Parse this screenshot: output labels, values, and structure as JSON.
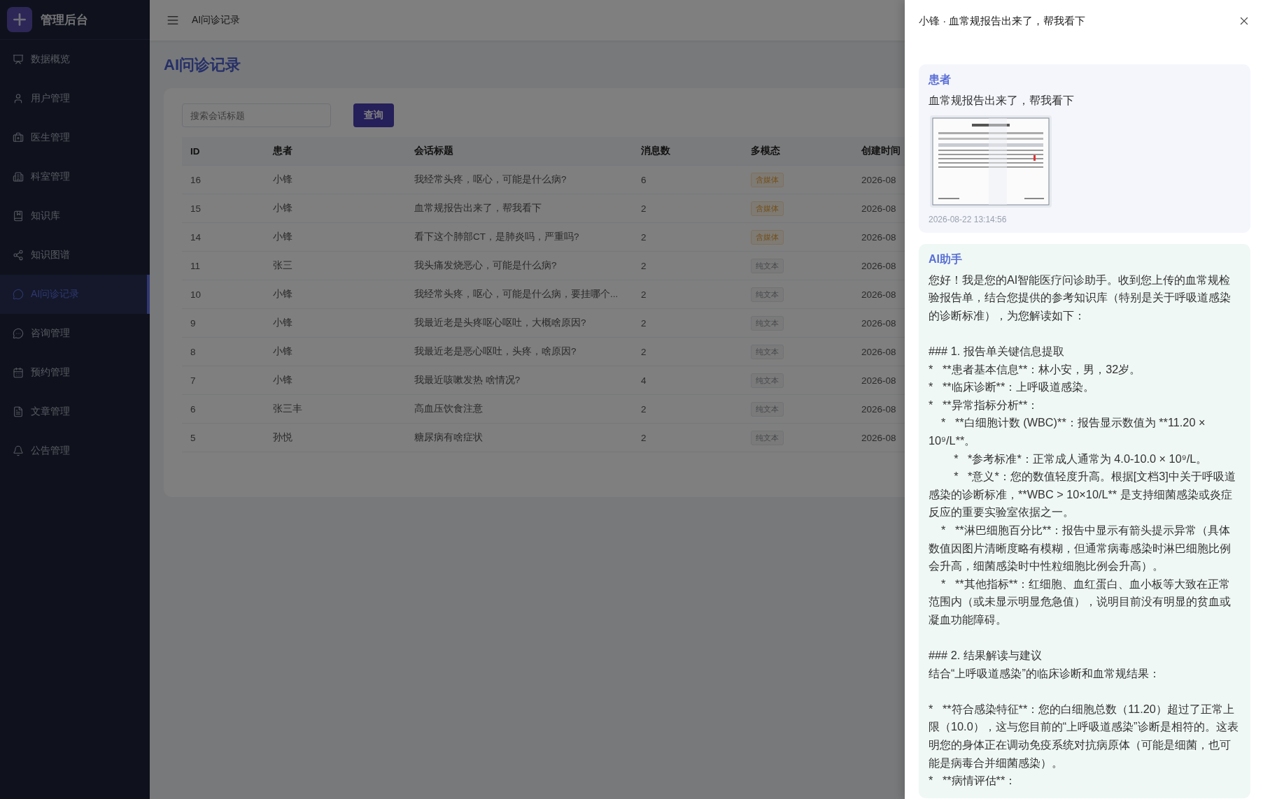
{
  "sidebar": {
    "brand": "管理后台",
    "items": [
      {
        "label": "数据概览",
        "selected": false
      },
      {
        "label": "用户管理",
        "selected": false
      },
      {
        "label": "医生管理",
        "selected": false
      },
      {
        "label": "科室管理",
        "selected": false
      },
      {
        "label": "知识库",
        "selected": false
      },
      {
        "label": "知识图谱",
        "selected": false
      },
      {
        "label": "AI问诊记录",
        "selected": true
      },
      {
        "label": "咨询管理",
        "selected": false
      },
      {
        "label": "预约管理",
        "selected": false
      },
      {
        "label": "文章管理",
        "selected": false
      },
      {
        "label": "公告管理",
        "selected": false
      }
    ]
  },
  "header": {
    "breadcrumb": "AI问诊记录"
  },
  "page": {
    "title": "AI问诊记录",
    "search": {
      "placeholder": "搜索会话标题"
    },
    "search_button": "查询"
  },
  "table": {
    "columns": [
      "ID",
      "患者",
      "会话标题",
      "消息数",
      "多模态",
      "创建时间"
    ],
    "rows": [
      {
        "id": "16",
        "patient": "小锋",
        "title": "我经常头疼，呕心，可能是什么病?",
        "count": "6",
        "modality": {
          "label": "含媒体",
          "kind": "media"
        },
        "created": "2026-08"
      },
      {
        "id": "15",
        "patient": "小锋",
        "title": "血常规报告出来了，帮我看下",
        "count": "2",
        "modality": {
          "label": "含媒体",
          "kind": "media"
        },
        "created": "2026-08"
      },
      {
        "id": "14",
        "patient": "小锋",
        "title": "看下这个肺部CT，是肺炎吗，严重吗?",
        "count": "2",
        "modality": {
          "label": "含媒体",
          "kind": "media"
        },
        "created": "2026-08"
      },
      {
        "id": "11",
        "patient": "张三",
        "title": "我头痛发烧恶心，可能是什么病?",
        "count": "2",
        "modality": {
          "label": "纯文本",
          "kind": "text"
        },
        "created": "2026-08"
      },
      {
        "id": "10",
        "patient": "小锋",
        "title": "我经常头疼，呕心，可能是什么病，要挂哪个...",
        "count": "2",
        "modality": {
          "label": "纯文本",
          "kind": "text"
        },
        "created": "2026-08"
      },
      {
        "id": "9",
        "patient": "小锋",
        "title": "我最近老是头疼呕心呕吐，大概啥原因?",
        "count": "2",
        "modality": {
          "label": "纯文本",
          "kind": "text"
        },
        "created": "2026-08"
      },
      {
        "id": "8",
        "patient": "小锋",
        "title": "我最近老是恶心呕吐，头疼，啥原因?",
        "count": "2",
        "modality": {
          "label": "纯文本",
          "kind": "text"
        },
        "created": "2026-08"
      },
      {
        "id": "7",
        "patient": "小锋",
        "title": "我最近咳嗽发热 啥情况?",
        "count": "4",
        "modality": {
          "label": "纯文本",
          "kind": "text"
        },
        "created": "2026-08"
      },
      {
        "id": "6",
        "patient": "张三丰",
        "title": "高血压饮食注意",
        "count": "2",
        "modality": {
          "label": "纯文本",
          "kind": "text"
        },
        "created": "2026-08"
      },
      {
        "id": "5",
        "patient": "孙悦",
        "title": "糖尿病有啥症状",
        "count": "2",
        "modality": {
          "label": "纯文本",
          "kind": "text"
        },
        "created": "2026-08"
      }
    ]
  },
  "drawer": {
    "title": "小锋 · 血常规报告出来了，帮我看下",
    "messages": [
      {
        "kind": "patient",
        "role": "患者",
        "paragraphs": [
          [
            "血常规报告出来了，帮我看下"
          ]
        ],
        "attachments": [
          {
            "kind": "picture"
          }
        ],
        "time": "2026-08-22 13:14:56"
      },
      {
        "kind": "assistant",
        "role": "AI助手",
        "paragraphs": [
          [
            "您好！我是您的AI智能医疗问诊助手。收到您上传的血常规检验报告单，结合您提供的参考知识库（特别是关于呼吸道感染的诊断标准），为您解读如下："
          ],
          [
            "### 1. 报告单关键信息提取",
            "*   **患者基本信息**：林小安，男，32岁。",
            "*   **临床诊断**：上呼吸道感染。",
            "*   **异常指标分析**：",
            "    *   **白细胞计数 (WBC)**：报告显示数值为 **11.20 × 10⁹/L**。",
            "        *   *参考标准*：正常成人通常为 4.0-10.0 × 10⁹/L。",
            "        *   *意义*：您的数值轻度升高。根据[文档3]中关于呼吸道感染的诊断标准，**WBC > 10×10/L** 是支持细菌感染或炎症反应的重要实验室依据之一。",
            "    *   **淋巴细胞百分比**：报告中显示有箭头提示异常（具体数值因图片清晰度略有模糊，但通常病毒感染时淋巴细胞比例会升高，细菌感染时中性粒细胞比例会升高）。",
            "    *   **其他指标**：红细胞、血红蛋白、血小板等大致在正常范围内（或未显示明显危急值），说明目前没有明显的贫血或凝血功能障碍。"
          ],
          [
            "### 2. 结果解读与建议",
            "结合“上呼吸道感染”的临床诊断和血常规结果："
          ],
          [
            "*   **符合感染特征**：您的白细胞总数（11.20）超过了正常上限（10.0），这与您目前的“上呼吸道感染”诊断是相符的。这表明您的身体正在调动免疫系统对抗病原体（可能是细菌，也可能是病毒合并细菌感染）。",
            "*   **病情评估**："
          ]
        ]
      }
    ]
  }
}
